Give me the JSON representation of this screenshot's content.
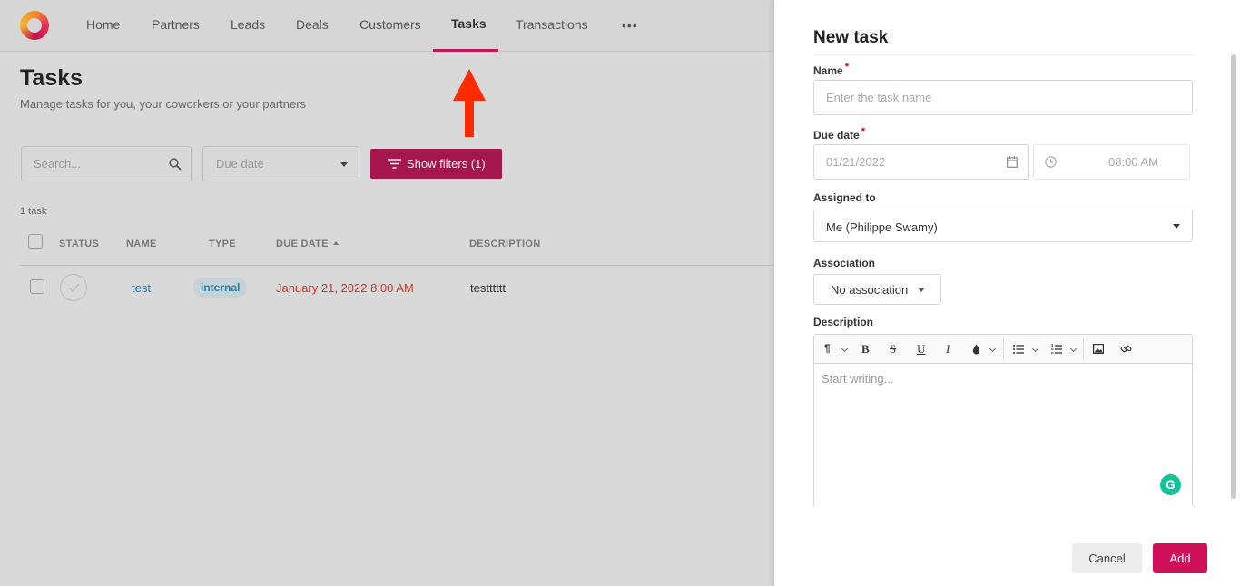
{
  "nav": {
    "items": [
      "Home",
      "Partners",
      "Leads",
      "Deals",
      "Customers",
      "Tasks",
      "Transactions"
    ],
    "active": "Tasks",
    "more": "•••"
  },
  "page": {
    "title": "Tasks",
    "subtitle": "Manage tasks for you, your coworkers or your partners"
  },
  "filters": {
    "search_placeholder": "Search...",
    "due_date_placeholder": "Due date",
    "show_filters_label": "Show filters (1)"
  },
  "table": {
    "count_label": "1 task",
    "columns": [
      "STATUS",
      "NAME",
      "TYPE",
      "DUE DATE",
      "DESCRIPTION"
    ],
    "rows": [
      {
        "name": "test",
        "type": "internal",
        "due_date": "January 21, 2022 8:00 AM",
        "description": "testttttt"
      }
    ]
  },
  "drawer": {
    "title": "New task",
    "name_label": "Name",
    "name_placeholder": "Enter the task name",
    "due_date_label": "Due date",
    "due_date_value": "01/21/2022",
    "time_value": "08:00 AM",
    "required_mark": "*",
    "assigned_label": "Assigned to",
    "assigned_value": "Me (Philippe Swamy)",
    "association_label": "Association",
    "association_value": "No association",
    "description_label": "Description",
    "editor_placeholder": "Start writing...",
    "toolbar": {
      "paragraph": "¶",
      "bold": "B",
      "strike": "S",
      "underline": "U",
      "italic": "I",
      "color": "💧"
    },
    "cancel_label": "Cancel",
    "add_label": "Add"
  },
  "colors": {
    "brand": "#d1105a",
    "filter_button": "#a3174d",
    "overdue": "#c0392b",
    "link": "#2a7aa8",
    "annotation_arrow": "#ff2a00"
  }
}
